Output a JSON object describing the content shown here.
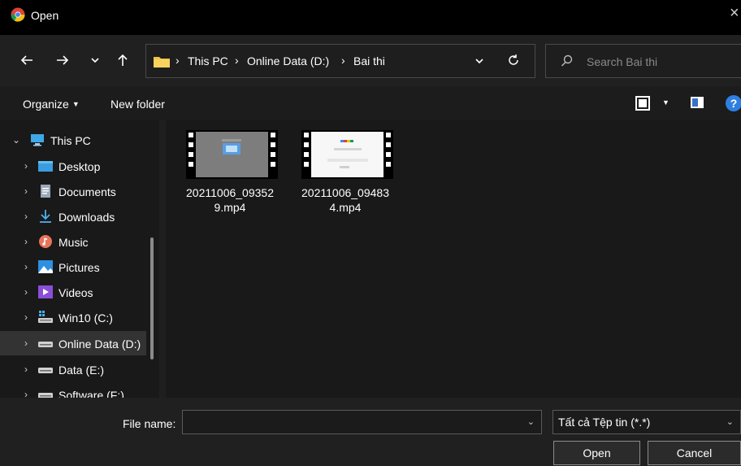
{
  "window": {
    "title": "Open"
  },
  "nav": {
    "breadcrumbs": [
      "This PC",
      "Online Data (D:)",
      "Bai thi"
    ],
    "search_placeholder": "Search Bai thi"
  },
  "toolbar": {
    "organize": "Organize",
    "new_folder": "New folder"
  },
  "sidebar": {
    "items": [
      {
        "label": "This PC",
        "expanded": true,
        "icon": "monitor-icon"
      },
      {
        "label": "Desktop",
        "icon": "desktop-folder-icon"
      },
      {
        "label": "Documents",
        "icon": "documents-icon"
      },
      {
        "label": "Downloads",
        "icon": "download-arrow-icon"
      },
      {
        "label": "Music",
        "icon": "music-icon"
      },
      {
        "label": "Pictures",
        "icon": "pictures-icon"
      },
      {
        "label": "Videos",
        "icon": "videos-icon"
      },
      {
        "label": "Win10 (C:)",
        "icon": "windows-drive-icon"
      },
      {
        "label": "Online Data (D:)",
        "icon": "drive-icon",
        "selected": true
      },
      {
        "label": "Data (E:)",
        "icon": "drive-icon"
      },
      {
        "label": "Software (F:)",
        "icon": "drive-icon"
      }
    ]
  },
  "files": [
    {
      "name_line1": "20211006_09352",
      "name_line2": "9.mp4",
      "thumb": "video-thumbnail-gray"
    },
    {
      "name_line1": "20211006_09483",
      "name_line2": "4.mp4",
      "thumb": "video-thumbnail-white"
    }
  ],
  "bottom": {
    "file_name_label": "File name:",
    "file_name_value": "",
    "filter_value": "Tất cả Tệp tin (*.*)",
    "open_label": "Open",
    "cancel_label": "Cancel"
  },
  "colors": {
    "accent": "#2f7fe0",
    "folder": "#f2c443",
    "background": "#191919"
  }
}
